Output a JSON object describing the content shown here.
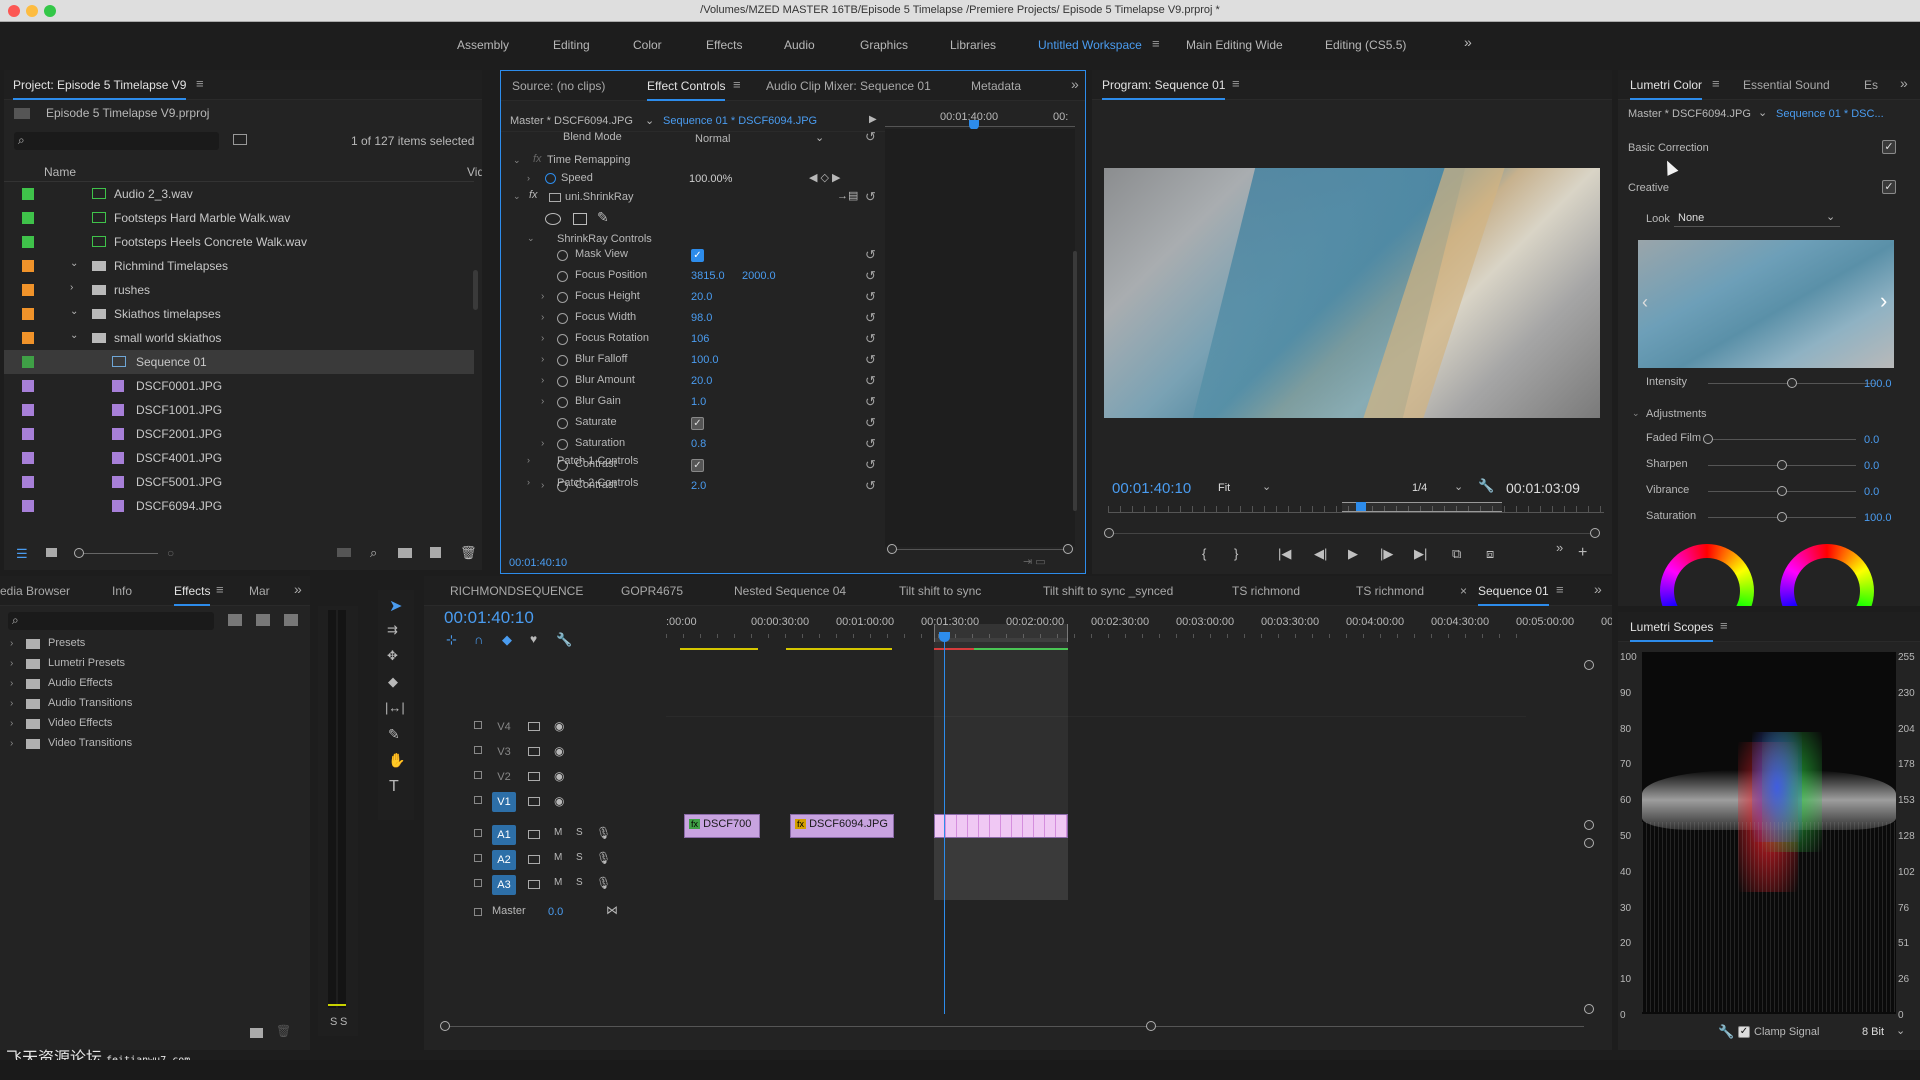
{
  "window": {
    "title": "/Volumes/MZED MASTER 16TB/Episode 5 Timelapse /Premiere Projects/ Episode 5 Timelapse V9.prproj *"
  },
  "workspaces": [
    "Assembly",
    "Editing",
    "Color",
    "Effects",
    "Audio",
    "Graphics",
    "Libraries",
    "Untitled Workspace",
    "Main Editing Wide",
    "Editing (CS5.5)"
  ],
  "project": {
    "title": "Project: Episode 5 Timelapse V9",
    "file": "Episode 5 Timelapse V9.prproj",
    "count": "1 of 127 items selected",
    "col_name": "Name",
    "col_vid": "Vid",
    "items": [
      {
        "name": "Audio 2_3.wav",
        "color": "#3fc24a"
      },
      {
        "name": "Footsteps Hard Marble Walk.wav",
        "color": "#3fc24a"
      },
      {
        "name": "Footsteps Heels Concrete Walk.wav",
        "color": "#3fc24a"
      },
      {
        "name": "Richmind Timelapses",
        "color": "#f0932a"
      },
      {
        "name": "rushes",
        "color": "#f0932a"
      },
      {
        "name": "Skiathos timelapses",
        "color": "#f0932a"
      },
      {
        "name": "small world skiathos",
        "color": "#f0932a"
      },
      {
        "name": "Sequence 01",
        "color": "#3fa046"
      },
      {
        "name": "DSCF0001.JPG",
        "color": "#a77fd8"
      },
      {
        "name": "DSCF1001.JPG",
        "color": "#a77fd8"
      },
      {
        "name": "DSCF2001.JPG",
        "color": "#a77fd8"
      },
      {
        "name": "DSCF4001.JPG",
        "color": "#a77fd8"
      },
      {
        "name": "DSCF5001.JPG",
        "color": "#a77fd8"
      },
      {
        "name": "DSCF6094.JPG",
        "color": "#a77fd8"
      }
    ]
  },
  "ec": {
    "tabs": [
      "Source: (no clips)",
      "Effect Controls",
      "Audio Clip Mixer: Sequence 01",
      "Metadata"
    ],
    "master": "Master * DSCF6094.JPG",
    "seq": "Sequence 01 * DSCF6094.JPG",
    "ruler_time": "00:01:40:00",
    "ruler_end": "00:",
    "blend_label": "Blend Mode",
    "blend_val": "Normal",
    "time_remap": "Time Remapping",
    "speed_label": "Speed",
    "speed_val": "100.00%",
    "effect": "uni.ShrinkRay",
    "group": "ShrinkRay Controls",
    "params": [
      {
        "name": "Mask View",
        "val": ""
      },
      {
        "name": "Focus Position",
        "val": "3815.0",
        "val2": "2000.0"
      },
      {
        "name": "Focus Height",
        "val": "20.0"
      },
      {
        "name": "Focus Width",
        "val": "98.0"
      },
      {
        "name": "Focus Rotation",
        "val": "106"
      },
      {
        "name": "Blur Falloff",
        "val": "100.0"
      },
      {
        "name": "Blur Amount",
        "val": "20.0"
      },
      {
        "name": "Blur Gain",
        "val": "1.0"
      },
      {
        "name": "Saturate",
        "val": ""
      },
      {
        "name": "Saturation",
        "val": "0.8"
      },
      {
        "name": "Contrast",
        "val": ""
      },
      {
        "name": "Contrast",
        "val": "2.0"
      }
    ],
    "patch1": "Patch 1 Controls",
    "patch2": "Patch 2 Controls",
    "timecode": "00:01:40:10"
  },
  "program": {
    "title": "Program: Sequence 01",
    "timecode": "00:01:40:10",
    "fit": "Fit",
    "res": "1/4",
    "duration": "00:01:03:09"
  },
  "lumetri": {
    "tabs": [
      "Lumetri Color",
      "Essential Sound",
      "Es"
    ],
    "master": "Master * DSCF6094.JPG",
    "seq": "Sequence 01 * DSC...",
    "basic": "Basic Correction",
    "creative": "Creative",
    "look_label": "Look",
    "look_val": "None",
    "intensity_label": "Intensity",
    "intensity_val": "100.0",
    "adjust": "Adjustments",
    "sliders": [
      {
        "name": "Faded Film",
        "val": "0.0",
        "level": 0
      },
      {
        "name": "Sharpen",
        "val": "0.0",
        "level": 0.5
      },
      {
        "name": "Vibrance",
        "val": "0.0",
        "level": 0.5
      },
      {
        "name": "Saturation",
        "val": "100.0",
        "level": 0.5
      }
    ]
  },
  "effects": {
    "tabs": [
      "edia Browser",
      "Info",
      "Effects",
      "Mar"
    ],
    "items": [
      "Presets",
      "Lumetri Presets",
      "Audio Effects",
      "Audio Transitions",
      "Video Effects",
      "Video Transitions"
    ]
  },
  "timeline": {
    "tabs": [
      "RICHMONDSEQUENCE",
      "GOPR4675",
      "Nested Sequence 04",
      "Tilt shift to sync",
      "Tilt shift to sync _synced",
      "TS richmond",
      "TS richmond",
      "Sequence 01"
    ],
    "timecode": "00:01:40:10",
    "ruler": [
      ":00:00",
      "00:00:30:00",
      "00:01:00:00",
      "00:01:30:00",
      "00:02:00:00",
      "00:02:30:00",
      "00:03:00:00",
      "00:03:30:00",
      "00:04:00:00",
      "00:04:30:00",
      "00:05:00:00",
      "00:0"
    ],
    "video_tracks": [
      "V4",
      "V3",
      "V2",
      "V1"
    ],
    "audio_tracks": [
      "A1",
      "A2",
      "A3"
    ],
    "master_label": "Master",
    "master_val": "0.0",
    "clips": [
      "DSCF700",
      "DSCF6094.JPG"
    ]
  },
  "scopes": {
    "title": "Lumetri Scopes",
    "left_axis": [
      "100",
      "90",
      "80",
      "70",
      "60",
      "50",
      "40",
      "30",
      "20",
      "10",
      "0"
    ],
    "right_axis": [
      "255",
      "230",
      "204",
      "178",
      "153",
      "128",
      "102",
      "76",
      "51",
      "26",
      "0"
    ],
    "clamp": "Clamp Signal",
    "bits": "8 Bit"
  },
  "audio_meter": {
    "s1": "S",
    "s2": "S"
  },
  "watermark": "飞天资源论坛",
  "watermark_url": "feitianwu7.com"
}
